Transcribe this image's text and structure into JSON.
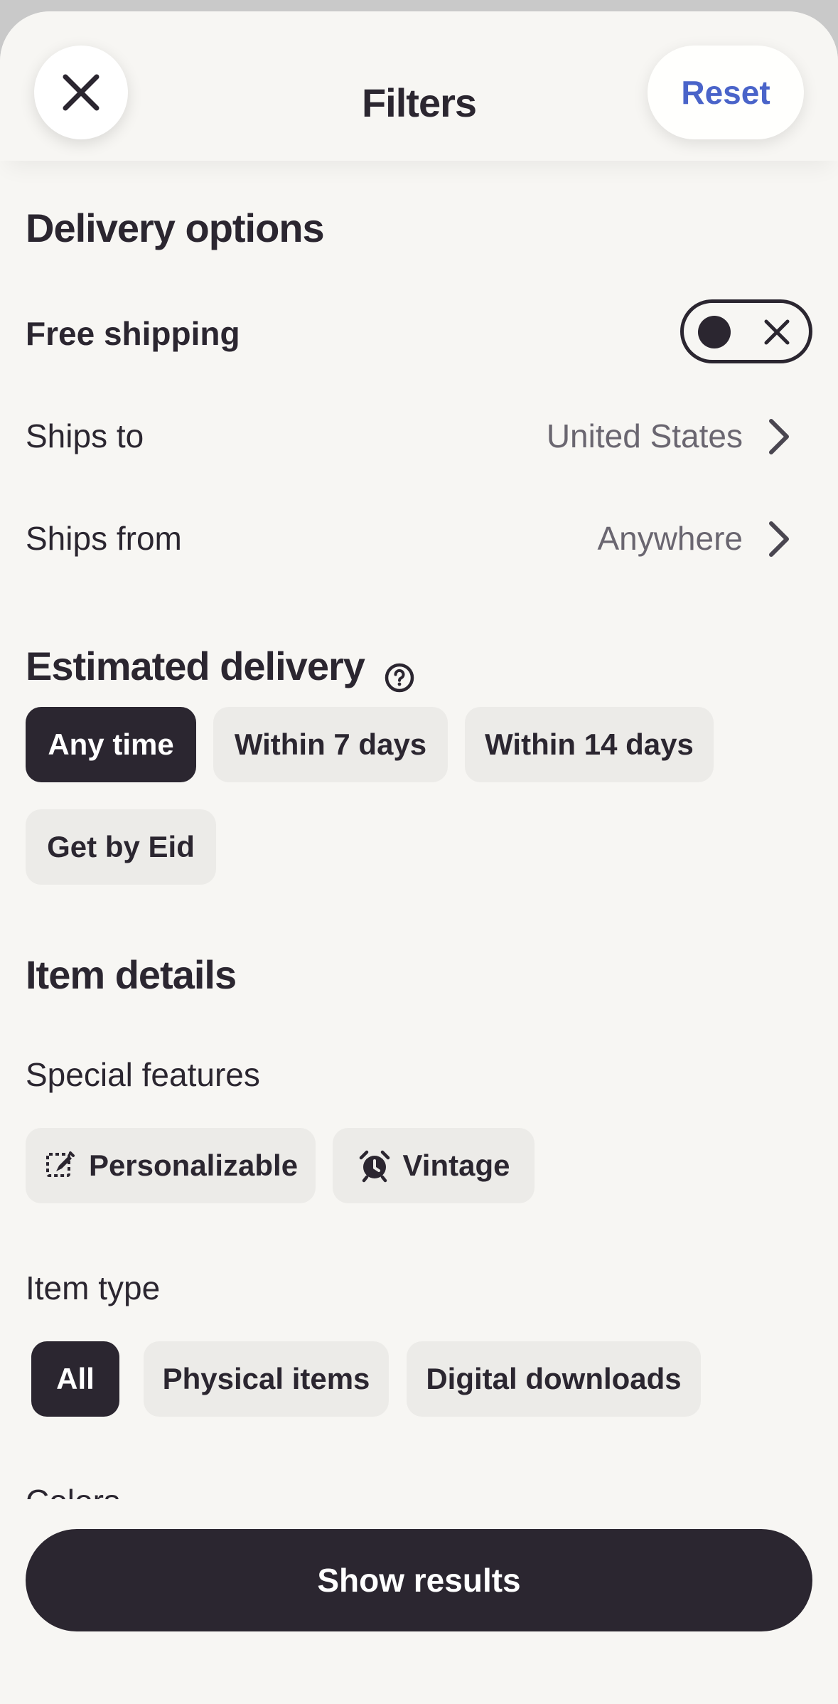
{
  "header": {
    "title": "Filters",
    "reset_label": "Reset",
    "close_icon": "close-icon"
  },
  "delivery": {
    "section_title": "Delivery options",
    "free_shipping_label": "Free shipping",
    "free_shipping_on": false,
    "ships_to_label": "Ships to",
    "ships_to_value": "United States",
    "ships_from_label": "Ships from",
    "ships_from_value": "Anywhere"
  },
  "estimated_delivery": {
    "title": "Estimated delivery",
    "help_icon": "help-circle-icon",
    "options": [
      {
        "label": "Any time",
        "selected": true
      },
      {
        "label": "Within 7 days",
        "selected": false
      },
      {
        "label": "Within 14 days",
        "selected": false
      },
      {
        "label": "Get by Eid",
        "selected": false
      }
    ]
  },
  "item_details": {
    "title": "Item details",
    "special_features_label": "Special features",
    "special_features": [
      {
        "label": "Personalizable",
        "icon": "personalize-icon"
      },
      {
        "label": "Vintage",
        "icon": "alarm-clock-icon"
      }
    ],
    "item_type_label": "Item type",
    "item_types": [
      {
        "label": "All",
        "selected": true
      },
      {
        "label": "Physical items",
        "selected": false
      },
      {
        "label": "Digital downloads",
        "selected": false
      }
    ],
    "next_section_label": "Colors"
  },
  "footer": {
    "show_results_label": "Show results"
  },
  "colors": {
    "accent": "#4a64c9",
    "dark": "#2b2630",
    "chip_bg": "#ecebe8",
    "background": "#f7f6f3"
  }
}
